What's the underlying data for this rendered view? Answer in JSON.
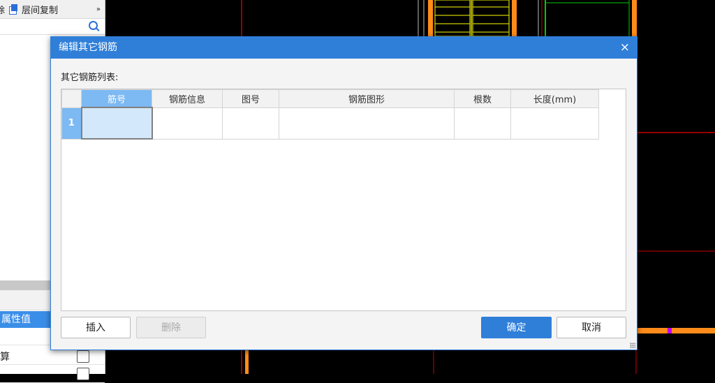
{
  "left_panel": {
    "toolbar": {
      "truncated_label": "除",
      "copy_floor_label": "层间复制",
      "more_glyph": "»"
    },
    "prop_value_header": "属性值",
    "row_text": "算"
  },
  "dialog": {
    "title": "编辑其它钢筋",
    "close_glyph": "×",
    "list_label": "其它钢筋列表:",
    "table": {
      "columns": [
        "筋号",
        "钢筋信息",
        "图号",
        "钢筋图形",
        "根数",
        "长度(mm)"
      ],
      "rows": [
        {
          "index": "1",
          "cells": [
            "",
            "",
            "",
            "",
            "",
            ""
          ]
        }
      ]
    },
    "buttons": {
      "insert": "插入",
      "delete": "删除",
      "ok": "确定",
      "cancel": "取消"
    }
  },
  "colors": {
    "accent": "#2f7fd9",
    "selected_header": "#7db9f2",
    "cad_orange": "#ff8c1a",
    "cad_red": "#cc0000",
    "cad_yellow": "#ffff00"
  }
}
